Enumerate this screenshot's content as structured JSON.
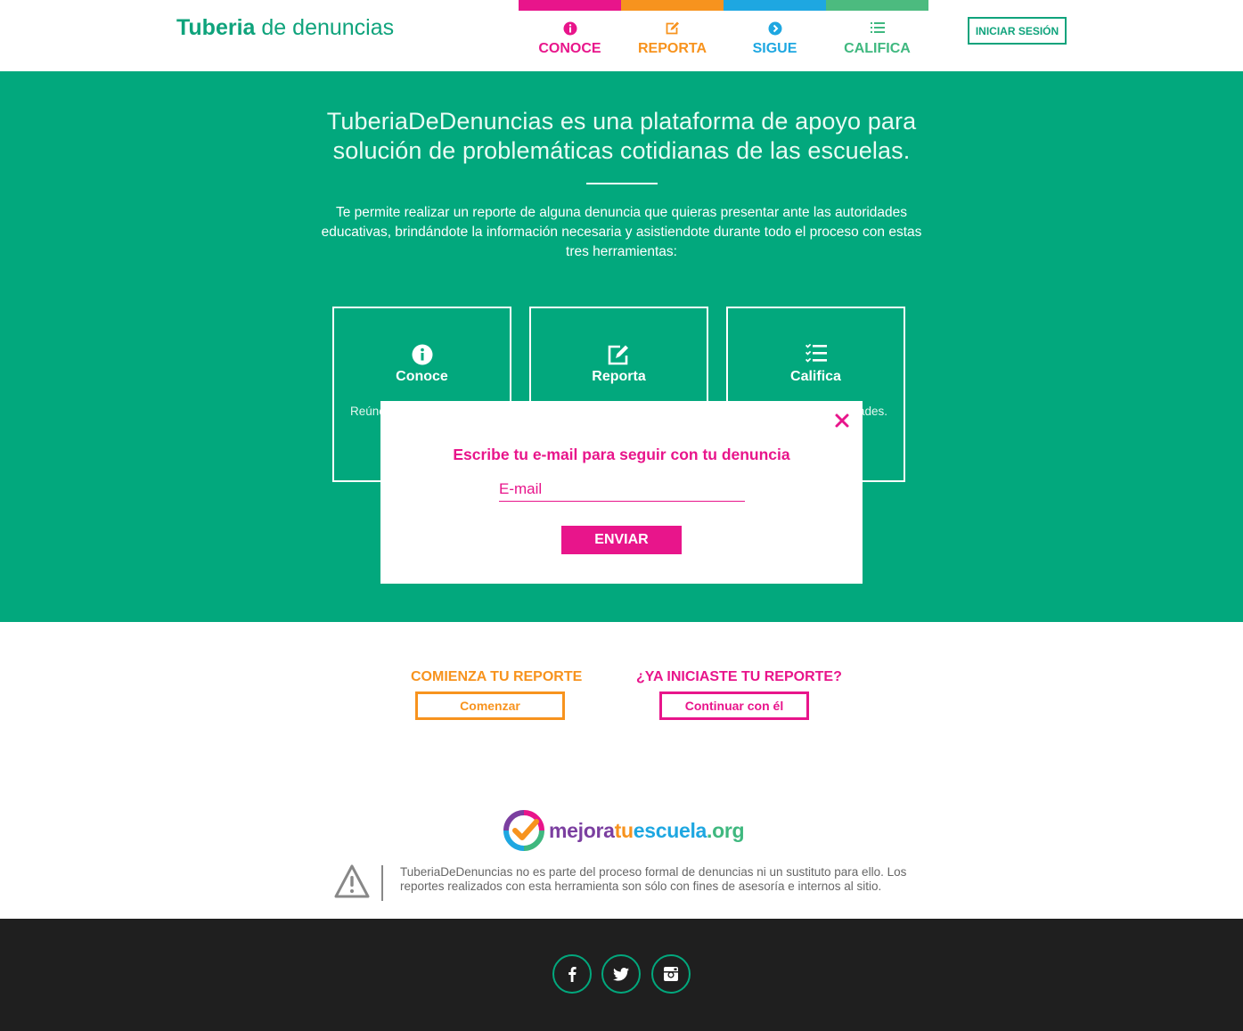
{
  "header": {
    "brand_bold": "Tuberia",
    "brand_light": "de denuncias",
    "login_label": "INICIAR SESIÓN"
  },
  "nav": [
    {
      "label": "CONOCE",
      "color": "#e8158b",
      "icon": "info-icon"
    },
    {
      "label": "REPORTA",
      "color": "#f7931e",
      "icon": "edit-icon"
    },
    {
      "label": "SIGUE",
      "color": "#1ea7e1",
      "icon": "chevron-right-icon"
    },
    {
      "label": "CALIFICA",
      "color": "#3fb87f",
      "icon": "list-icon"
    }
  ],
  "hero": {
    "title": "TuberiaDeDenuncias es una plataforma de apoyo para solución de problemáticas cotidianas de las escuelas.",
    "text": "Te permite realizar un reporte de alguna denuncia que quieras presentar ante las autoridades educativas, brindándote la información necesaria y asistiendote durante todo el proceso con estas tres herramientas:"
  },
  "cards": [
    {
      "title": "Conoce",
      "desc": "Reúne que d pres",
      "icon": "info-icon"
    },
    {
      "title": "Reporta",
      "desc": "",
      "icon": "edit-icon"
    },
    {
      "title": "Califica",
      "desc": "nión e te ades.",
      "icon": "list-icon"
    }
  ],
  "modal": {
    "title": "Escribe tu e-mail para seguir con tu denuncia",
    "email_placeholder": "E-mail",
    "send_label": "ENVIAR"
  },
  "actions": {
    "start_title": "COMIENZA TU REPORTE",
    "start_button": "Comenzar",
    "continue_title": "¿YA INICIASTE TU REPORTE?",
    "continue_button": "Continuar con él"
  },
  "logo": {
    "part1": "mejora",
    "part2": "tu",
    "part3": "escuela",
    "part4": ".org"
  },
  "disclaimer": "TuberiaDeDenuncias no es parte del proceso formal de denuncias ni un sustituto para ello. Los reportes realizados con esta herramienta son sólo con fines de asesoría e internos al sitio.",
  "footer": {
    "social": [
      "facebook-icon",
      "twitter-icon",
      "instagram-icon"
    ]
  },
  "colors": {
    "green": "#02a87d",
    "pink": "#e8158b",
    "orange": "#f7931e",
    "blue": "#1ea7e1"
  }
}
